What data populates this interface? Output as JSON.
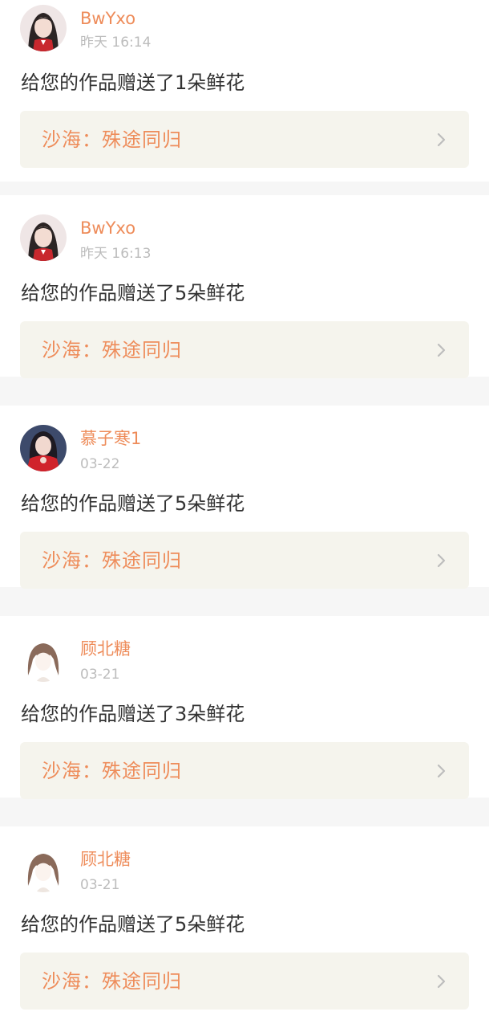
{
  "notifications": [
    {
      "username": "BwYxo",
      "time": "昨天 16:14",
      "message": "给您的作品赠送了1朵鲜花",
      "work_title": "沙海：殊途同归",
      "avatar_icon": "girl-red-uniform-avatar"
    },
    {
      "username": "BwYxo",
      "time": "昨天 16:13",
      "message": "给您的作品赠送了5朵鲜花",
      "work_title": "沙海：殊途同归",
      "avatar_icon": "girl-red-uniform-avatar"
    },
    {
      "username": "慕子寒1",
      "time": "03-22",
      "message": "给您的作品赠送了5朵鲜花",
      "work_title": "沙海：殊途同归",
      "avatar_icon": "girl-red-dress-avatar"
    },
    {
      "username": "顾北糖",
      "time": "03-21",
      "message": "给您的作品赠送了3朵鲜花",
      "work_title": "沙海：殊途同归",
      "avatar_icon": "illustrated-girl-avatar"
    },
    {
      "username": "顾北糖",
      "time": "03-21",
      "message": "给您的作品赠送了5朵鲜花",
      "work_title": "沙海：殊途同归",
      "avatar_icon": "illustrated-girl-avatar"
    }
  ],
  "colors": {
    "accent": "#ee8c5a",
    "text": "#333333",
    "muted": "#bcbcbc",
    "link_bg": "#f5f4ed",
    "separator": "#f6f6f6"
  }
}
